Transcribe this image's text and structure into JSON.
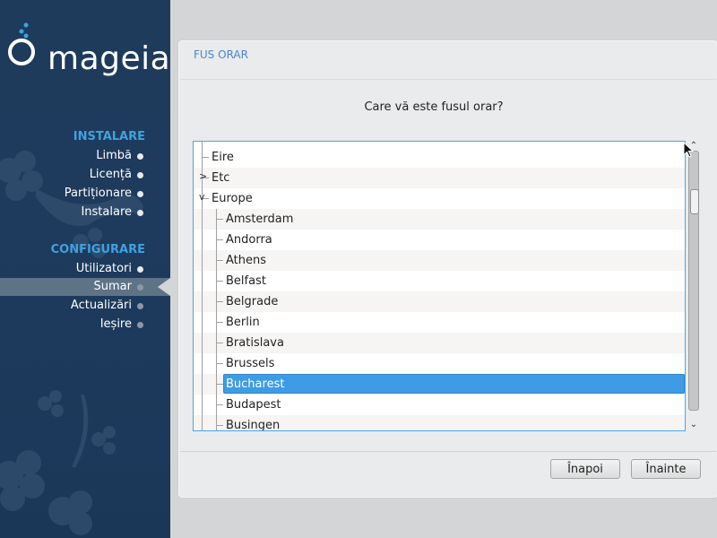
{
  "brand": {
    "name": "mageia"
  },
  "sidebar": {
    "sections": [
      {
        "title": "INSTALARE",
        "items": [
          {
            "label": "Limbă"
          },
          {
            "label": "Licență"
          },
          {
            "label": "Partiționare"
          },
          {
            "label": "Instalare"
          }
        ]
      },
      {
        "title": "CONFIGURARE",
        "items": [
          {
            "label": "Utilizatori"
          },
          {
            "label": "Sumar",
            "active": true
          },
          {
            "label": "Actualizări"
          },
          {
            "label": "Ieșire"
          }
        ]
      }
    ]
  },
  "panel": {
    "title": "FUS ORAR",
    "question": "Care vă este fusul orar?",
    "tree": {
      "rows": [
        {
          "label": "Eire",
          "level": 0
        },
        {
          "label": "Etc",
          "level": 0,
          "expander": ">"
        },
        {
          "label": "Europe",
          "level": 0,
          "expander": "v"
        },
        {
          "label": "Amsterdam",
          "level": 1
        },
        {
          "label": "Andorra",
          "level": 1
        },
        {
          "label": "Athens",
          "level": 1
        },
        {
          "label": "Belfast",
          "level": 1
        },
        {
          "label": "Belgrade",
          "level": 1
        },
        {
          "label": "Berlin",
          "level": 1
        },
        {
          "label": "Bratislava",
          "level": 1
        },
        {
          "label": "Brussels",
          "level": 1
        },
        {
          "label": "Bucharest",
          "level": 1,
          "selected": true
        },
        {
          "label": "Budapest",
          "level": 1
        },
        {
          "label": "Busingen",
          "level": 1
        }
      ]
    },
    "buttons": {
      "back": "Înapoi",
      "next": "Înainte"
    }
  },
  "colors": {
    "accent": "#3fa2e0",
    "selection": "#3d9ce3",
    "sidebar_bg": "#1f3b5c"
  }
}
